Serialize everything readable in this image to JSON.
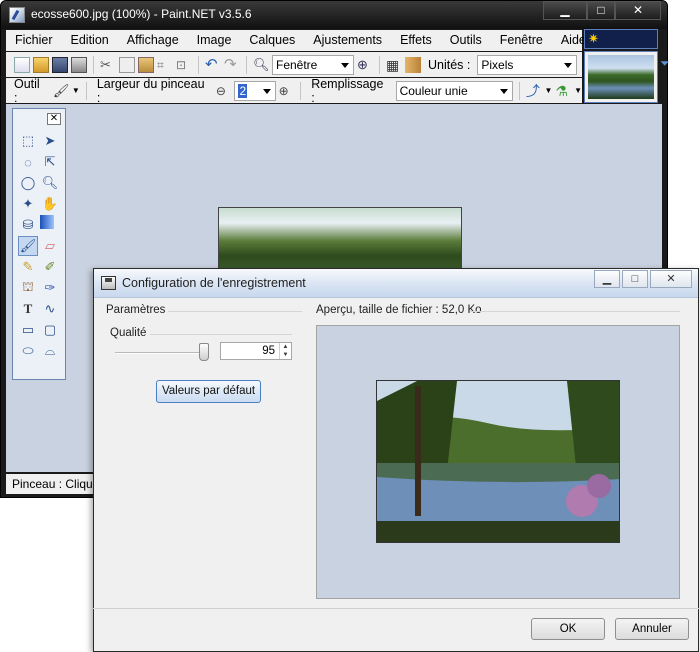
{
  "window": {
    "title": "ecosse600.jpg (100%) - Paint.NET v3.5.6",
    "minimize": "▁",
    "maximize": "□",
    "close": "✕"
  },
  "menu": [
    "Fichier",
    "Edition",
    "Affichage",
    "Image",
    "Calques",
    "Ajustements",
    "Effets",
    "Outils",
    "Fenêtre",
    "Aide"
  ],
  "toolbar1": {
    "zoom_combo": "Fenêtre",
    "units_label": "Unités :",
    "units_combo": "Pixels"
  },
  "toolbar2": {
    "tool_label": "Outil :",
    "brush_width_label": "Largeur du pinceau :",
    "brush_width_value": "2",
    "fill_label": "Remplissage :",
    "fill_combo": "Couleur unie"
  },
  "toolbox": {
    "close": "✕"
  },
  "statusbar": {
    "text": "Pinceau : Clique"
  },
  "dialog": {
    "title": "Configuration de l'enregistrement",
    "params_label": "Paramètres",
    "preview_label": "Aperçu, taille de fichier : 52,0 Ko",
    "quality_label": "Qualité",
    "quality_value": "95",
    "quality_percent": 95,
    "default_button": "Valeurs par défaut",
    "ok_button": "OK",
    "cancel_button": "Annuler",
    "minimize": "▁",
    "maximize": "□",
    "close": "✕"
  },
  "colors": {
    "canvas_bg": "#c9d2e0",
    "dialog_bg": "#f0f0f0",
    "titlebar_dark": "#1a1a1a"
  }
}
